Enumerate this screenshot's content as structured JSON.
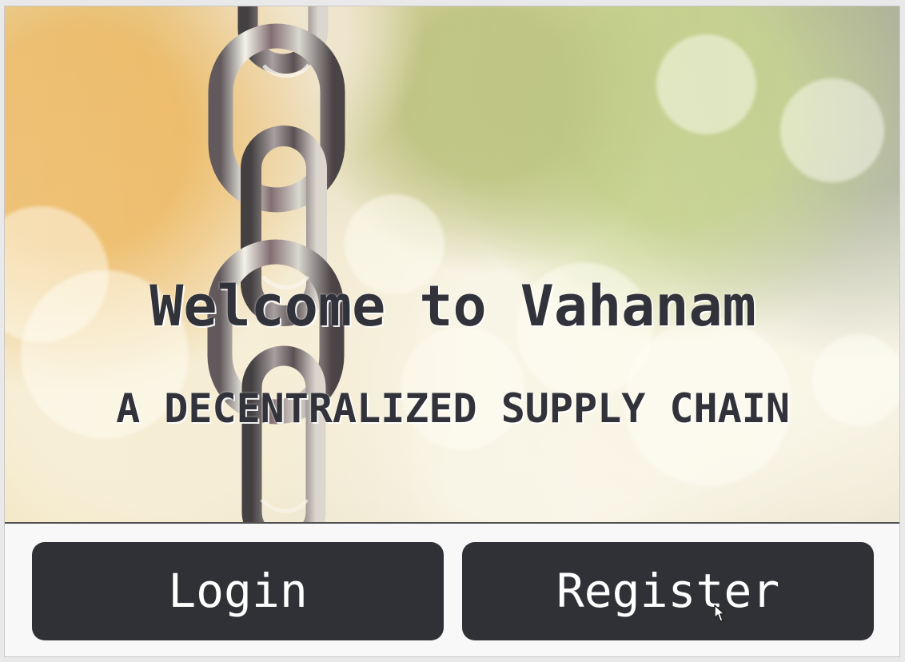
{
  "hero": {
    "title": "Welcome to Vahanam",
    "subtitle": "A DECENTRALIZED SUPPLY CHAIN"
  },
  "actions": {
    "login_label": "Login",
    "register_label": "Register"
  },
  "icons": {
    "background_visual": "chain-icon",
    "pointer": "mouse-pointer-icon"
  },
  "colors": {
    "button_background": "#303137",
    "button_text": "#ffffff",
    "heading_text": "#31323a",
    "divider": "#515151"
  }
}
